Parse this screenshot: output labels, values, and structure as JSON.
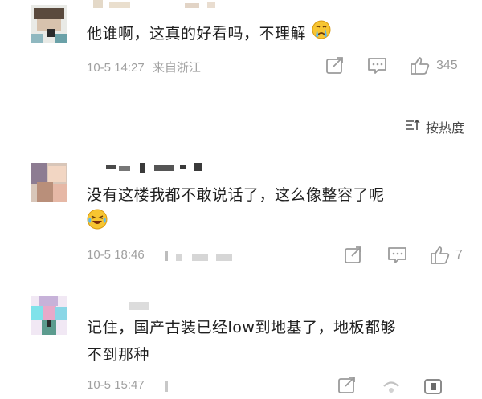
{
  "comments": [
    {
      "text": "他谁啊，这真的好看吗，不理解",
      "emoji": "crying-face-emoji",
      "date": "10-5 14:27",
      "location": "来自浙江",
      "likes": "345"
    },
    {
      "text_line1": "没有这楼我都不敢说话了，这么像整容了呢",
      "emoji": "laughing-crying-emoji",
      "date": "10-5 18:46",
      "likes": "7"
    },
    {
      "text_line1": "记住，国产古装已经low到地基了，地板都够",
      "text_line2": "不到那种",
      "date": "10-5 15:47"
    }
  ],
  "sort": {
    "label": "按热度",
    "icon": "sort-icon"
  },
  "colors": {
    "icon_gray": "#9b9b9b",
    "text": "#1f1f1f",
    "meta": "#a0a0a0"
  }
}
